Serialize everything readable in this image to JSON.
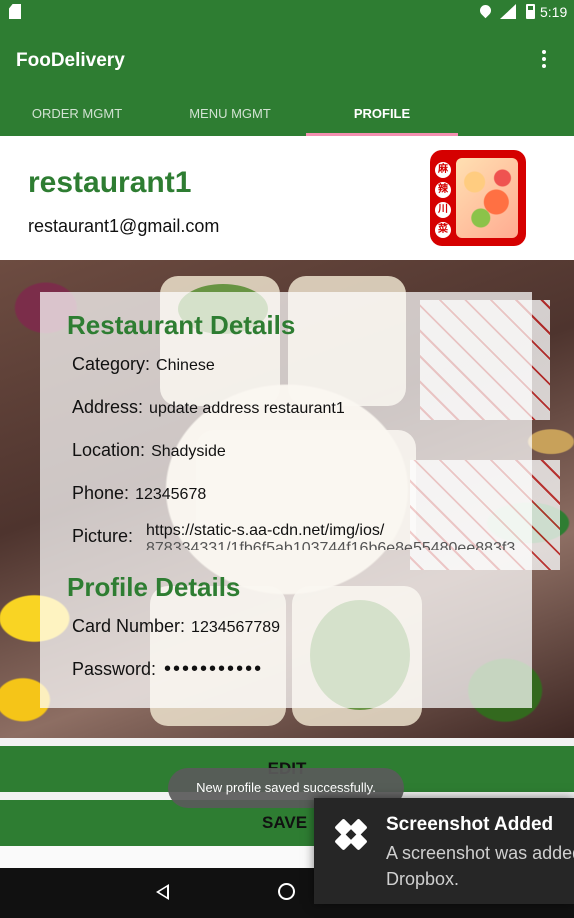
{
  "status_bar": {
    "time": "5:19",
    "icons": [
      "sd-card-icon",
      "location-icon",
      "signal-icon",
      "battery-icon"
    ]
  },
  "app_bar": {
    "title": "FooDelivery",
    "color": "#2e7d32",
    "tabs": [
      {
        "label": "ORDER MGMT",
        "active": false
      },
      {
        "label": "MENU MGMT",
        "active": false
      },
      {
        "label": "PROFILE",
        "active": true
      }
    ],
    "tab_indicator_color": "#f48fb1"
  },
  "header": {
    "restaurant_name": "restaurant1",
    "email": "restaurant1@gmail.com",
    "logo_chars": [
      "麻",
      "辣",
      "川",
      "菜"
    ]
  },
  "restaurant_details": {
    "title": "Restaurant Details",
    "fields": {
      "category": {
        "label": "Category:",
        "value": "Chinese"
      },
      "address": {
        "label": "Address:",
        "value": "update address restaurant1"
      },
      "location": {
        "label": "Location:",
        "value": "Shadyside"
      },
      "phone": {
        "label": "Phone:",
        "value": "12345678"
      },
      "picture": {
        "label": "Picture:",
        "value_line1": "https://static-s.aa-cdn.net/img/ios/",
        "value_line2": "878334331/1fb6f5ab103744f16b6e8e55480ee883f3"
      }
    }
  },
  "profile_details": {
    "title": "Profile Details",
    "fields": {
      "card_number": {
        "label": "Card Number:",
        "value": "1234567789"
      },
      "password": {
        "label": "Password:",
        "value": "•••••••••••"
      }
    }
  },
  "buttons": {
    "edit_label": "EDIT",
    "save_label": "SAVE"
  },
  "toast": {
    "message": "New profile saved successfully."
  },
  "notification": {
    "title": "Screenshot Added",
    "body_line1": "A screenshot was added to",
    "body_line2": "Dropbox."
  },
  "nav_bar": {
    "icons": [
      "back-icon",
      "home-icon"
    ]
  }
}
